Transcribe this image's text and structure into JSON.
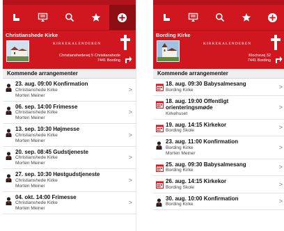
{
  "brand": "KIRKEKALENDEREN",
  "section_title": "Kommende arrangementer",
  "colors": {
    "primary": "#d0171f",
    "active_tab": "#8d0f14",
    "priest_icon": "#d0171f",
    "calendar_icon": "#d0171f"
  },
  "toolbar_icons": [
    "church-icon",
    "screen-icon",
    "search-icon",
    "star-icon",
    "add-circle-icon"
  ],
  "left": {
    "church_name": "Christianshede Kirke",
    "address_line1": "Christianshedevej 5 Christianshede",
    "address_line2": "7441 Bording",
    "events": [
      {
        "title": "23. aug. 09:00 Konfirmation",
        "location": "Christianshede Kirke",
        "person": "Morten Meiner",
        "icon": "priest-icon"
      },
      {
        "title": "06. sep. 14:00 Frimesse",
        "location": "Christianshede Kirke",
        "person": "Morten Meiner",
        "icon": "priest-icon"
      },
      {
        "title": "13. sep. 10:30 Højmesse",
        "location": "Christianshede Kirke",
        "person": "Morten Meiner",
        "icon": "priest-icon"
      },
      {
        "title": "20. sep. 08:45 Gudstjeneste",
        "location": "Christianshede Kirke",
        "person": "Morten Meiner",
        "icon": "priest-icon"
      },
      {
        "title": "27. sep. 10:30 Høstgudstjeneste",
        "location": "Christianshede Kirke",
        "person": "Morten Meiner",
        "icon": "priest-icon"
      },
      {
        "title": "04. okt. 14:00 Frimesse",
        "location": "Christianshede Kirke",
        "person": "Morten Meiner",
        "icon": "priest-icon"
      }
    ]
  },
  "right": {
    "church_name": "Bording Kirke",
    "address_line1": "Klochsvej 32",
    "address_line2": "7441 Bording",
    "events": [
      {
        "title": "18. aug. 09:30 Babysalmesang",
        "location": "Bording Kirke",
        "icon": "calendar-icon"
      },
      {
        "title": "18. aug. 19:00 Offentligt orienteringsmøde",
        "location": "Kirkehuset",
        "icon": "calendar-icon"
      },
      {
        "title": "19. aug. 14:15 Kirkekor",
        "location": "Bording Skole",
        "icon": "calendar-icon"
      },
      {
        "title": "23. aug. 11:00 Konfirmation",
        "location": "Bording Kirke",
        "person": "Morten Meiner",
        "icon": "priest-icon"
      },
      {
        "title": "25. aug. 09:30 Babysalmesang",
        "location": "Bording Kirke",
        "icon": "calendar-icon"
      },
      {
        "title": "26. aug. 14:15 Kirkekor",
        "location": "Bording Skole",
        "icon": "calendar-icon"
      },
      {
        "title": "30. aug. 10:00 Konfirmation",
        "location": "Bording Kirke",
        "icon": "priest-icon"
      }
    ]
  }
}
